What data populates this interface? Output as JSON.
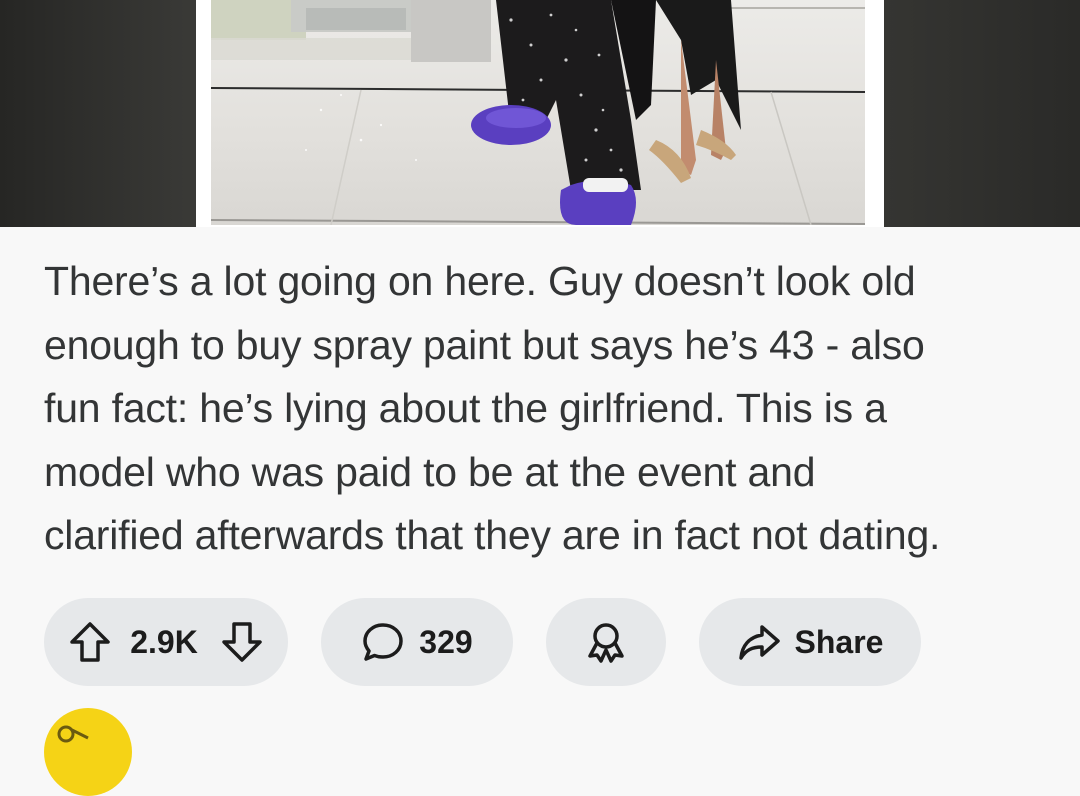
{
  "post": {
    "body_lines": [
      "There’s a lot going on here. Guy doesn’t look old",
      "enough to buy spray paint but says he’s 43 - also",
      "fun fact: he’s lying about the girlfriend. This is a",
      "model who was paid to be at the event and",
      "clarified afterwards that they are in fact not dating."
    ]
  },
  "actions": {
    "vote_count": "2.9K",
    "comment_count": "329",
    "share_label": "Share"
  },
  "icons": {
    "upvote": "arrow-up-icon",
    "downvote": "arrow-down-icon",
    "comment": "speech-bubble-icon",
    "award": "award-ribbon-icon",
    "share": "share-arrow-icon"
  },
  "colors": {
    "background": "#f8f8f8",
    "pill": "#e6e8ea",
    "text": "#333536",
    "avatar": "#f5d316"
  }
}
